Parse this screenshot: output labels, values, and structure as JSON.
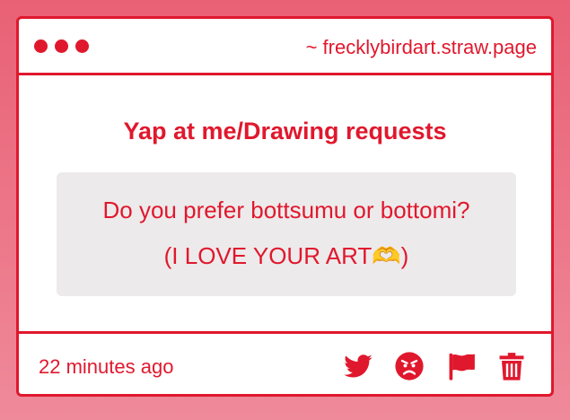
{
  "window": {
    "url": "~ frecklybirdart.straw.page"
  },
  "main": {
    "heading": "Yap at me/Drawing requests",
    "message_line1": "Do you prefer bottsumu or bottomi?",
    "message_line2": "(I LOVE YOUR ART🫶)"
  },
  "footer": {
    "timestamp": "22 minutes ago",
    "icons": [
      "twitter-icon",
      "angry-face-icon",
      "flag-icon",
      "trash-icon"
    ]
  },
  "colors": {
    "accent": "#e0182d",
    "background": "#e96175",
    "message_box": "#edeaeb"
  }
}
